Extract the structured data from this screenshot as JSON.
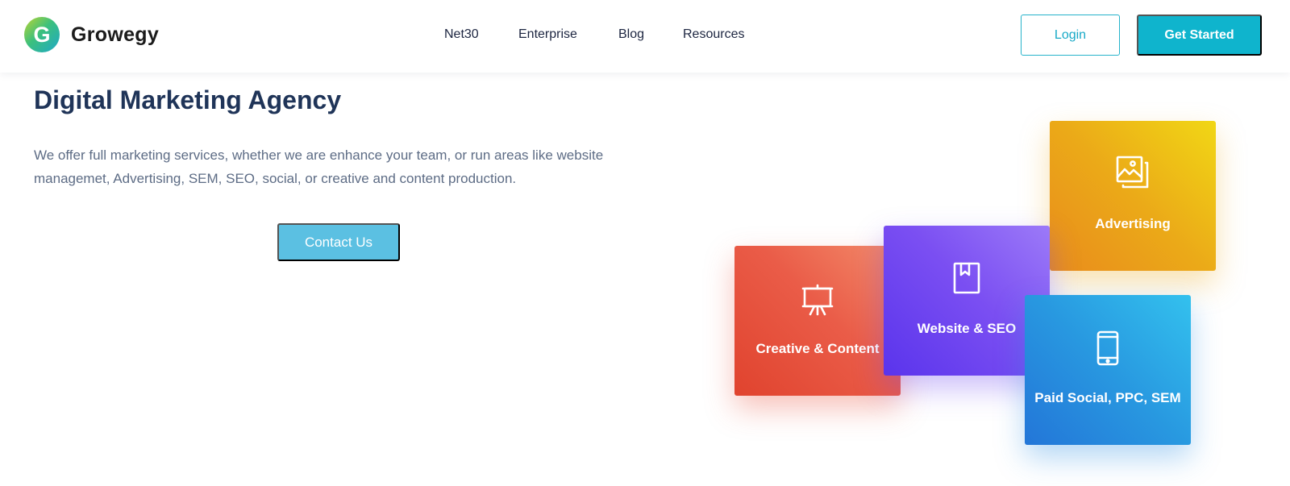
{
  "header": {
    "logo": {
      "mark": "G",
      "name": "Growegy"
    },
    "nav": [
      {
        "label": "Net30",
        "name": "nav-net30"
      },
      {
        "label": "Enterprise",
        "name": "nav-enterprise"
      },
      {
        "label": "Blog",
        "name": "nav-blog"
      },
      {
        "label": "Resources",
        "name": "nav-resources"
      }
    ],
    "login_label": "Login",
    "get_started_label": "Get Started"
  },
  "hero": {
    "title": "Digital Marketing Agency",
    "description": "We offer full marketing services, whether we are enhance your team, or run areas like website managemet, Advertising, SEM, SEO, social, or creative and content production.",
    "cta_label": "Contact Us"
  },
  "services": [
    {
      "label": "Creative & Content",
      "icon": "easel-icon",
      "color": "#e8543f"
    },
    {
      "label": "Website & SEO",
      "icon": "bookmark-book-icon",
      "color": "#7048f0"
    },
    {
      "label": "Advertising",
      "icon": "image-gallery-icon",
      "color": "#ecae18"
    },
    {
      "label": "Paid Social, PPC, SEM",
      "icon": "tablet-icon",
      "color": "#2a8fe0"
    }
  ],
  "colors": {
    "brand_teal": "#0fb4cd",
    "title_navy": "#1f3458",
    "contact_button": "#5bc0e2"
  }
}
